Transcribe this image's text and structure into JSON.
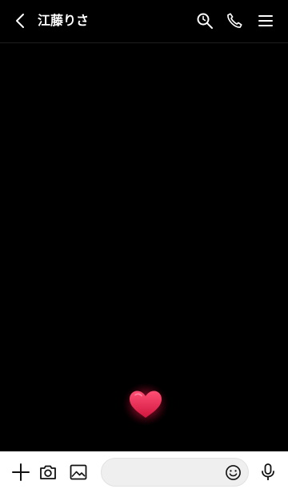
{
  "header": {
    "title": "江藤りさ",
    "icons": [
      "chevron-left-icon",
      "search-icon",
      "phone-icon",
      "menu-icon"
    ]
  },
  "chat": {
    "background_color": "#000000",
    "sticker": "heart-icon",
    "accent_color": "#e0244e"
  },
  "footer": {
    "icons": [
      "plus-icon",
      "camera-icon",
      "image-icon",
      "emoji-icon",
      "microphone-icon"
    ],
    "message_input": {
      "value": "",
      "placeholder": ""
    }
  }
}
